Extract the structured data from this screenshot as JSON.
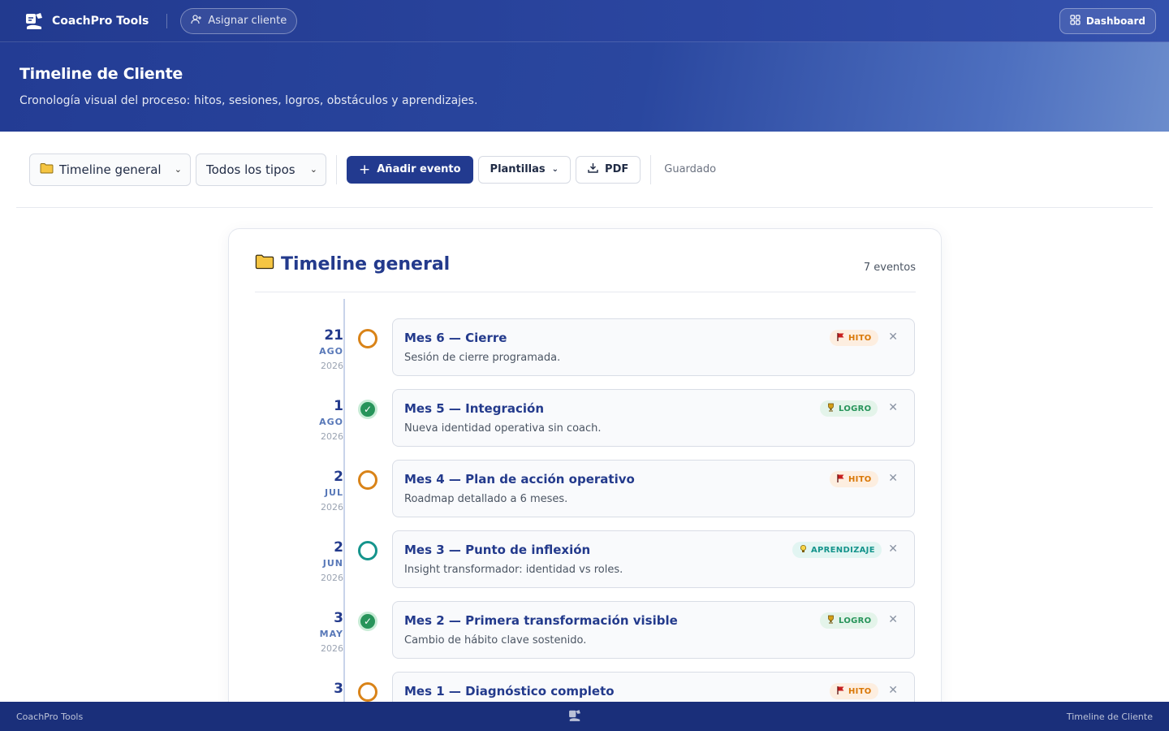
{
  "brand": {
    "name": "CoachPro Tools"
  },
  "nav": {
    "assign_label": "Asignar cliente",
    "dashboard_label": "Dashboard"
  },
  "hero": {
    "title": "Timeline de Cliente",
    "subtitle": "Cronología visual del proceso: hitos, sesiones, logros, obstáculos y aprendizajes."
  },
  "toolbar": {
    "timeline_select": "Timeline general",
    "type_select": "Todos los tipos",
    "add_label": "Añadir evento",
    "templates_label": "Plantillas",
    "pdf_label": "PDF",
    "status": "Guardado"
  },
  "card": {
    "title": "Timeline general",
    "count": "7 eventos"
  },
  "events": [
    {
      "day": "21",
      "month": "AGO",
      "year": "2026",
      "title": "Mes 6 — Cierre",
      "desc": "Sesión de cierre programada.",
      "badge": "HITO",
      "type": "hito"
    },
    {
      "day": "1",
      "month": "AGO",
      "year": "2026",
      "title": "Mes 5 — Integración",
      "desc": "Nueva identidad operativa sin coach.",
      "badge": "LOGRO",
      "type": "logro"
    },
    {
      "day": "2",
      "month": "JUL",
      "year": "2026",
      "title": "Mes 4 — Plan de acción operativo",
      "desc": "Roadmap detallado a 6 meses.",
      "badge": "HITO",
      "type": "hito"
    },
    {
      "day": "2",
      "month": "JUN",
      "year": "2026",
      "title": "Mes 3 — Punto de inflexión",
      "desc": "Insight transformador: identidad vs roles.",
      "badge": "APRENDIZAJE",
      "type": "aprend"
    },
    {
      "day": "3",
      "month": "MAY",
      "year": "2026",
      "title": "Mes 2 — Primera transformación visible",
      "desc": "Cambio de hábito clave sostenido.",
      "badge": "LOGRO",
      "type": "logro"
    },
    {
      "day": "3",
      "month": "",
      "year": "",
      "title": "Mes 1 — Diagnóstico completo",
      "desc": "",
      "badge": "HITO",
      "type": "hito"
    }
  ],
  "footer": {
    "left": "CoachPro Tools",
    "right": "Timeline de Cliente"
  },
  "colors": {
    "primary": "#223a8f",
    "hito": "#d98318",
    "logro": "#27945a",
    "aprendizaje": "#15948c"
  }
}
